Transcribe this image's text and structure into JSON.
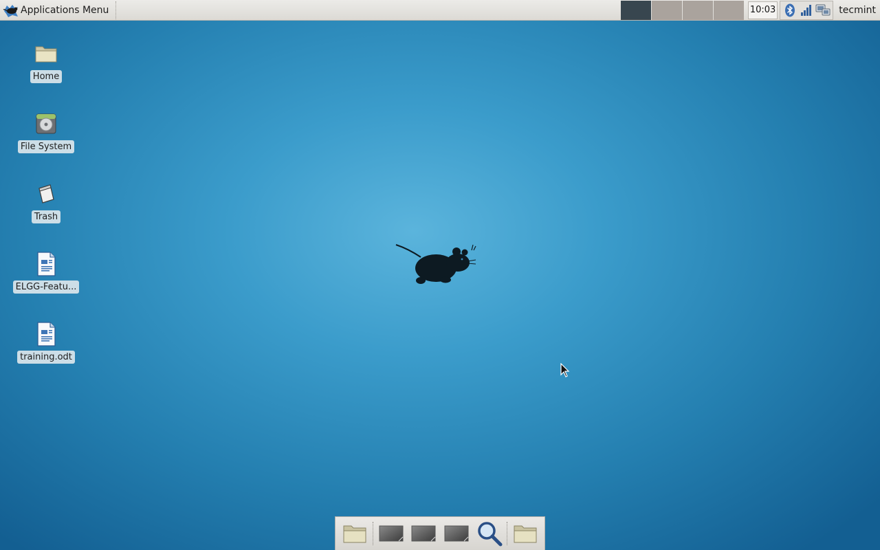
{
  "panel": {
    "menu_label": "Applications Menu",
    "workspaces": [
      {
        "name": "workspace-1",
        "active": true
      },
      {
        "name": "workspace-2",
        "active": false
      },
      {
        "name": "workspace-3",
        "active": false
      },
      {
        "name": "workspace-4",
        "active": false
      }
    ],
    "clock": "10:03",
    "tray_icons": [
      "bluetooth-icon",
      "network-signal-icon",
      "network-manager-icon"
    ],
    "username": "tecmint"
  },
  "desktop": {
    "icons": [
      {
        "label": "Home",
        "icon": "home-folder-icon"
      },
      {
        "label": "File System",
        "icon": "filesystem-icon"
      },
      {
        "label": "Trash",
        "icon": "trash-icon"
      },
      {
        "label": "ELGG-Featu...",
        "icon": "document-icon"
      },
      {
        "label": "training.odt",
        "icon": "document-icon"
      }
    ]
  },
  "dock": {
    "items": [
      "file-manager-icon",
      "window-icon",
      "window-icon",
      "window-icon",
      "app-finder-icon",
      "folder-icon"
    ]
  },
  "colors": {
    "wallpaper_center": "#5bb4dc",
    "wallpaper_edge": "#135f92",
    "active_workspace": "#38464f",
    "inactive_workspace": "#aaa39d"
  }
}
